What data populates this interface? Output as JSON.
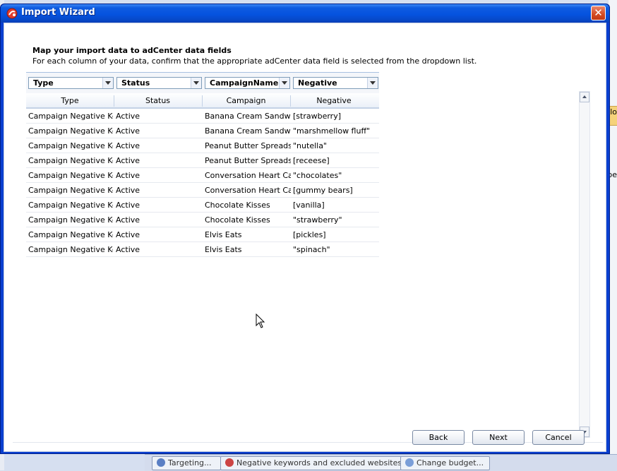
{
  "dialog": {
    "title": "Import Wizard",
    "close_label": "✕",
    "header_title": "Map your import data to adCenter data fields",
    "header_subtitle": "For each column of your data, confirm that the appropriate adCenter data field is selected from the dropdown list."
  },
  "mapping": {
    "dropdowns": [
      "Type",
      "Status",
      "CampaignName",
      "Negative"
    ],
    "columns": [
      "Type",
      "Status",
      "Campaign",
      "Negative"
    ],
    "rows": [
      [
        "Campaign Negative Keyword",
        "Active",
        "Banana Cream Sandwich",
        "[strawberry]"
      ],
      [
        "Campaign Negative Keyword",
        "Active",
        "Banana Cream Sandwich",
        "\"marshmellow fluff\""
      ],
      [
        "Campaign Negative Keyword",
        "Active",
        "Peanut Butter Spreads",
        "\"nutella\""
      ],
      [
        "Campaign Negative Keyword",
        "Active",
        "Peanut Butter Spreads",
        "[receese]"
      ],
      [
        "Campaign Negative Keyword",
        "Active",
        "Conversation Heart Candy",
        "\"chocolates\""
      ],
      [
        "Campaign Negative Keyword",
        "Active",
        "Conversation Heart Candy",
        "[gummy bears]"
      ],
      [
        "Campaign Negative Keyword",
        "Active",
        "Chocolate Kisses",
        "[vanilla]"
      ],
      [
        "Campaign Negative Keyword",
        "Active",
        "Chocolate Kisses",
        "\"strawberry\""
      ],
      [
        "Campaign Negative Keyword",
        "Active",
        "Elvis Eats",
        "[pickles]"
      ],
      [
        "Campaign Negative Keyword",
        "Active",
        "Elvis Eats",
        "\"spinach\""
      ]
    ]
  },
  "buttons": {
    "back": "Back",
    "next": "Next",
    "cancel": "Cancel"
  },
  "background": {
    "tasks": [
      "Targeting...",
      "Negative keywords and excluded websites",
      "Change budget..."
    ],
    "right_text_1": "lo",
    "right_text_2": "pe"
  },
  "colors": {
    "title_bar": "#0553df",
    "close_button": "#d34a22",
    "window_border": "#0a3fd0"
  }
}
